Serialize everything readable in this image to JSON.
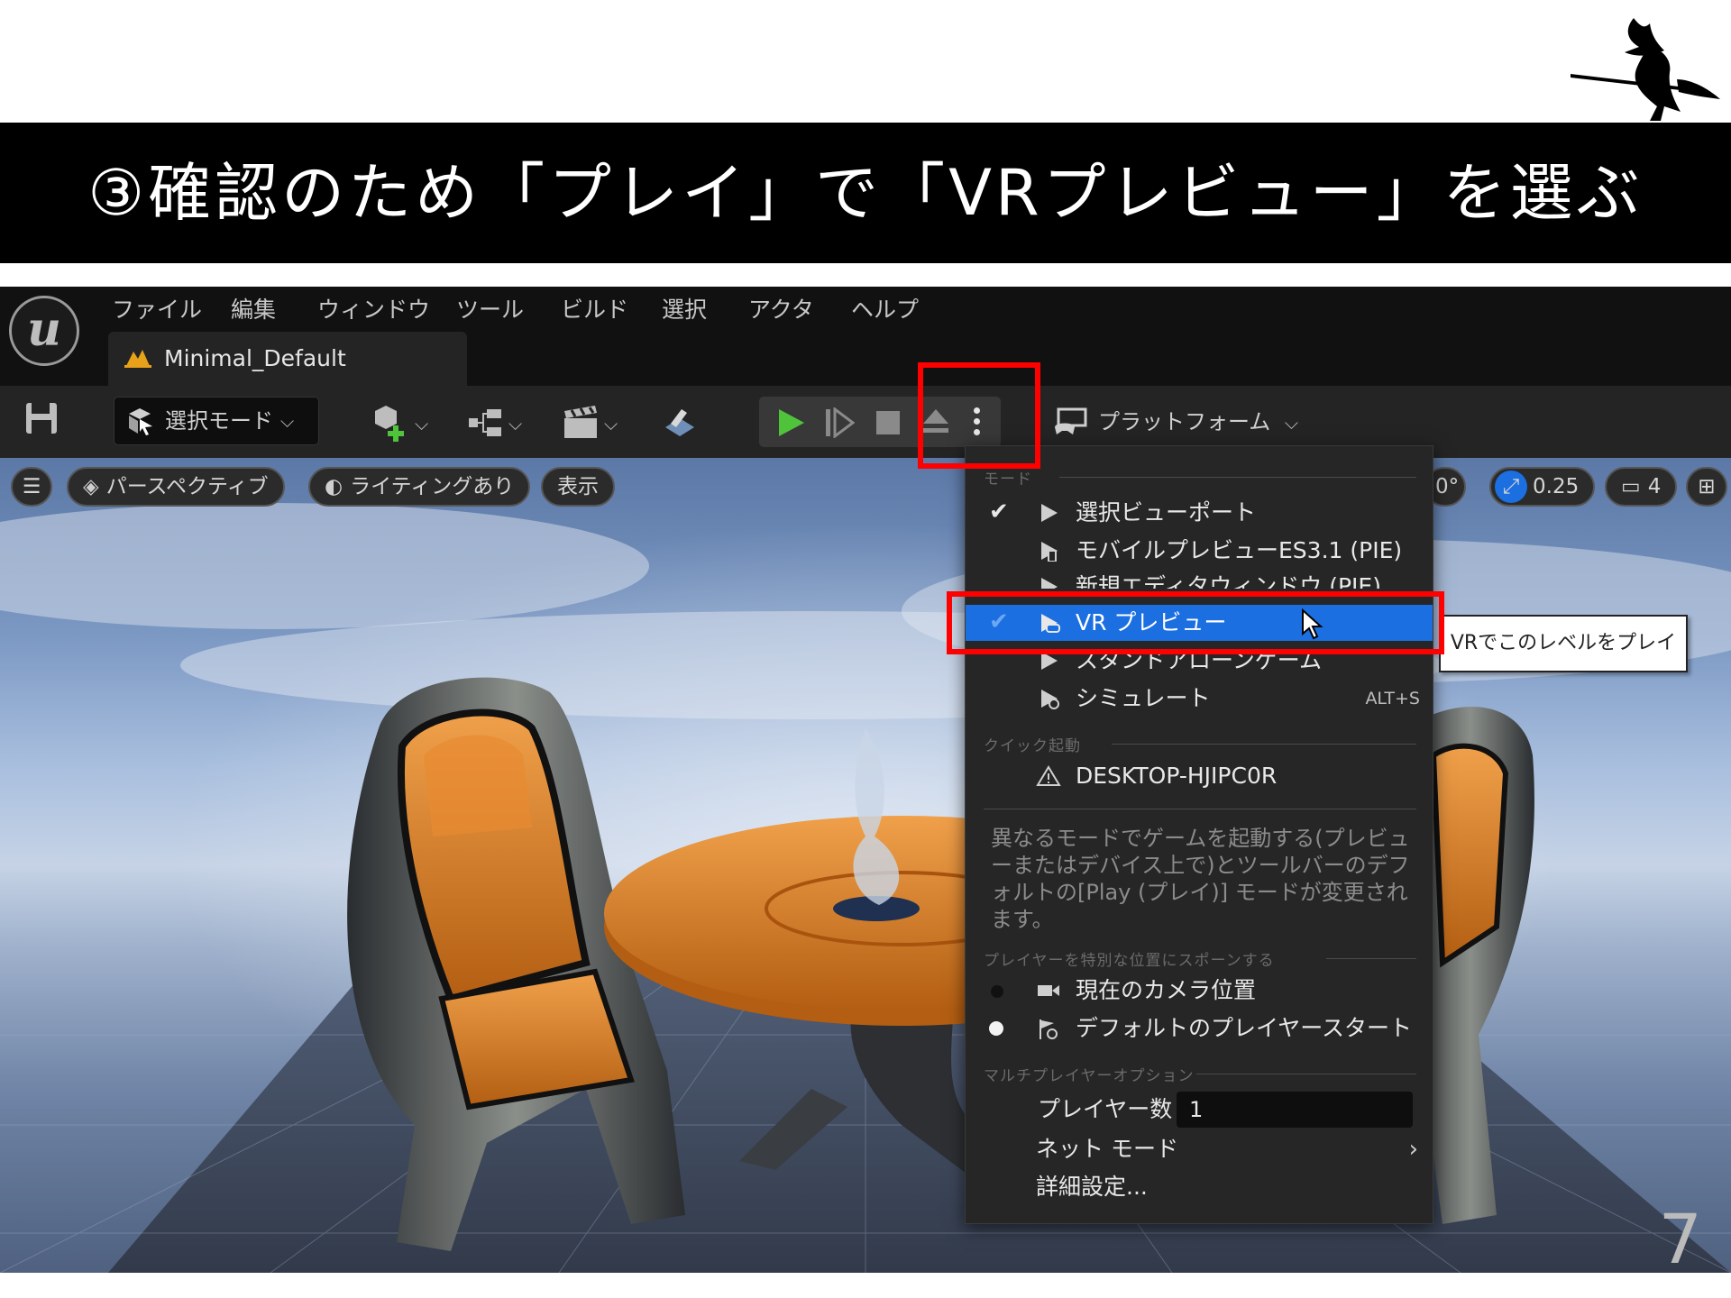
{
  "slide": {
    "title": "③確認のため「プレイ」で「VRプレビュー」を選ぶ",
    "page_number": "7",
    "highlight_color": "#ff0000"
  },
  "editor": {
    "menu": [
      "ファイル",
      "編集",
      "ウィンドウ",
      "ツール",
      "ビルド",
      "選択",
      "アクタ",
      "ヘルプ"
    ],
    "level_tab": "Minimal_Default",
    "toolbar": {
      "mode_label": "選択モード",
      "platform_label": "プラットフォーム"
    },
    "viewport": {
      "perspective_label": "パースペクティブ",
      "lighting_label": "ライティングあり",
      "show_label": "表示",
      "rotation_snap": "0°",
      "scale_snap": "0.25",
      "camera_speed": "4"
    }
  },
  "dropdown": {
    "mode_header": "モード",
    "modes": [
      {
        "label": "選択ビューポート",
        "checked": true,
        "icon": "play-icon"
      },
      {
        "label": "モバイルプレビューES3.1 (PIE)",
        "checked": false,
        "icon": "mobile-play-icon"
      },
      {
        "label": "新規エディタウィンドウ (PIE)",
        "checked": false,
        "icon": "window-play-icon"
      },
      {
        "label": "VR プレビュー",
        "checked": true,
        "icon": "vr-play-icon"
      },
      {
        "label": "スタンドアローンゲーム",
        "checked": false,
        "icon": "standalone-play-icon"
      },
      {
        "label": "シミュレート",
        "checked": false,
        "icon": "simulate-icon",
        "shortcut": "ALT+S"
      }
    ],
    "quick_launch_header": "クイック起動",
    "device": "DESKTOP-HJIPC0R",
    "description": "異なるモードでゲームを起動する(プレビューまたはデバイス上で)とツールバーのデフォルトの[Play (プレイ)] モードが変更されます。",
    "spawn_header": "プレイヤーを特別な位置にスポーンする",
    "spawn_options": [
      "現在のカメラ位置",
      "デフォルトのプレイヤースタート"
    ],
    "spawn_selected": 1,
    "multiplayer_header": "マルチプレイヤーオプション",
    "player_count_label": "プレイヤー数",
    "player_count_value": "1",
    "net_mode_label": "ネット モード",
    "advanced_label": "詳細設定..."
  },
  "tooltip": "VRでこのレベルをプレイ"
}
